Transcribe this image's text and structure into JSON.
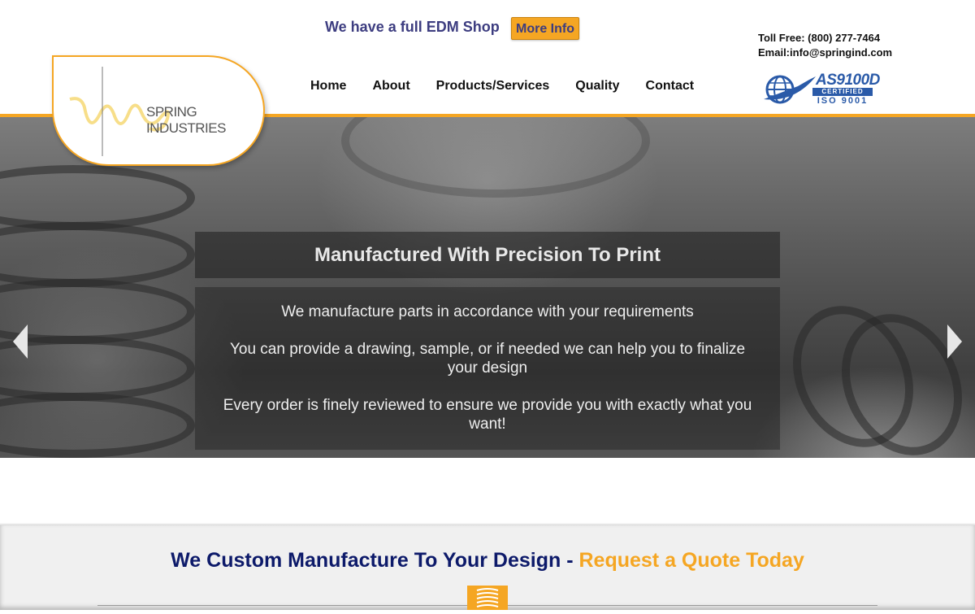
{
  "topbar": {
    "edm_text": "We have a full EDM Shop",
    "more_info_label": "More Info"
  },
  "contact": {
    "toll_free": "Toll Free: (800) 277-7464",
    "email": "Email:info@springind.com"
  },
  "logo": {
    "text": "SPRING INDUSTRIES"
  },
  "nav": {
    "items": [
      {
        "label": "Home"
      },
      {
        "label": "About"
      },
      {
        "label": "Products/Services"
      },
      {
        "label": "Quality"
      },
      {
        "label": "Contact"
      }
    ]
  },
  "certification": {
    "line1": "AS9100D",
    "line2": "CERTIFIED",
    "line3": "ISO 9001"
  },
  "slider": {
    "title": "Manufactured With Precision To Print",
    "paragraphs": [
      "We manufacture parts in accordance with your requirements",
      "You can provide a drawing, sample, or if needed we can help you to finalize your design",
      "Every order is finely reviewed to ensure we provide you with exactly what you want!"
    ]
  },
  "cta": {
    "headline_part1": "We Custom Manufacture To Your Design - ",
    "headline_part2": "Request a Quote Today"
  },
  "colors": {
    "accent": "#f5a623",
    "navy": "#0d1a6a",
    "badge_blue": "#2a5aa8"
  }
}
